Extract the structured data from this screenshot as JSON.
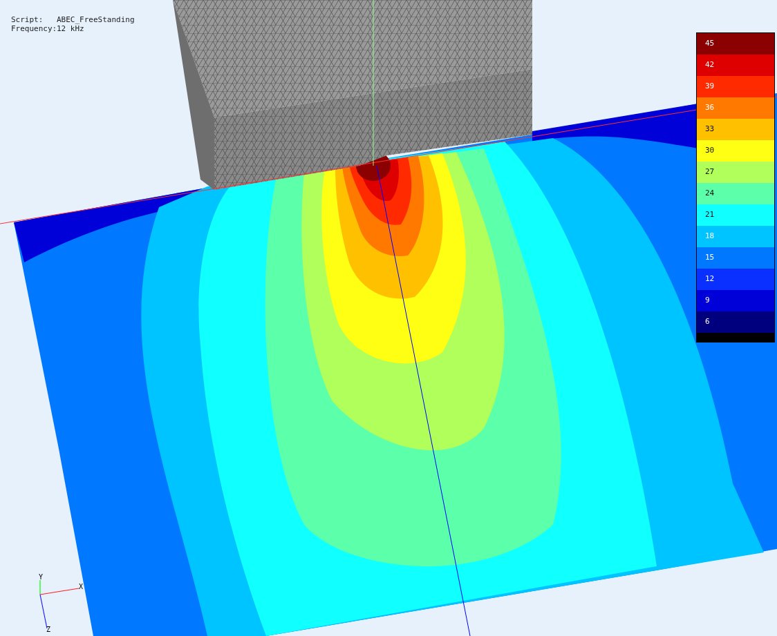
{
  "info": [
    {
      "label": "Script:",
      "value": "ABEC_FreeStanding"
    },
    {
      "label": "Frequency:",
      "value": "12 kHz"
    }
  ],
  "legend": {
    "items": [
      {
        "label": "45",
        "color": "#8b0000"
      },
      {
        "label": "42",
        "color": "#de0000"
      },
      {
        "label": "39",
        "color": "#ff2a00"
      },
      {
        "label": "36",
        "color": "#ff7800"
      },
      {
        "label": "33",
        "color": "#ffc000"
      },
      {
        "label": "30",
        "color": "#ffff14"
      },
      {
        "label": "27",
        "color": "#b0ff5a"
      },
      {
        "label": "24",
        "color": "#5cffaa"
      },
      {
        "label": "21",
        "color": "#10ffff"
      },
      {
        "label": "18",
        "color": "#00c4ff"
      },
      {
        "label": "15",
        "color": "#0078ff"
      },
      {
        "label": "12",
        "color": "#0a30ff"
      },
      {
        "label": "9",
        "color": "#0000d8"
      },
      {
        "label": "6",
        "color": "#00007e"
      }
    ]
  },
  "axes": {
    "x": "X",
    "y": "Y",
    "z": "Z"
  }
}
